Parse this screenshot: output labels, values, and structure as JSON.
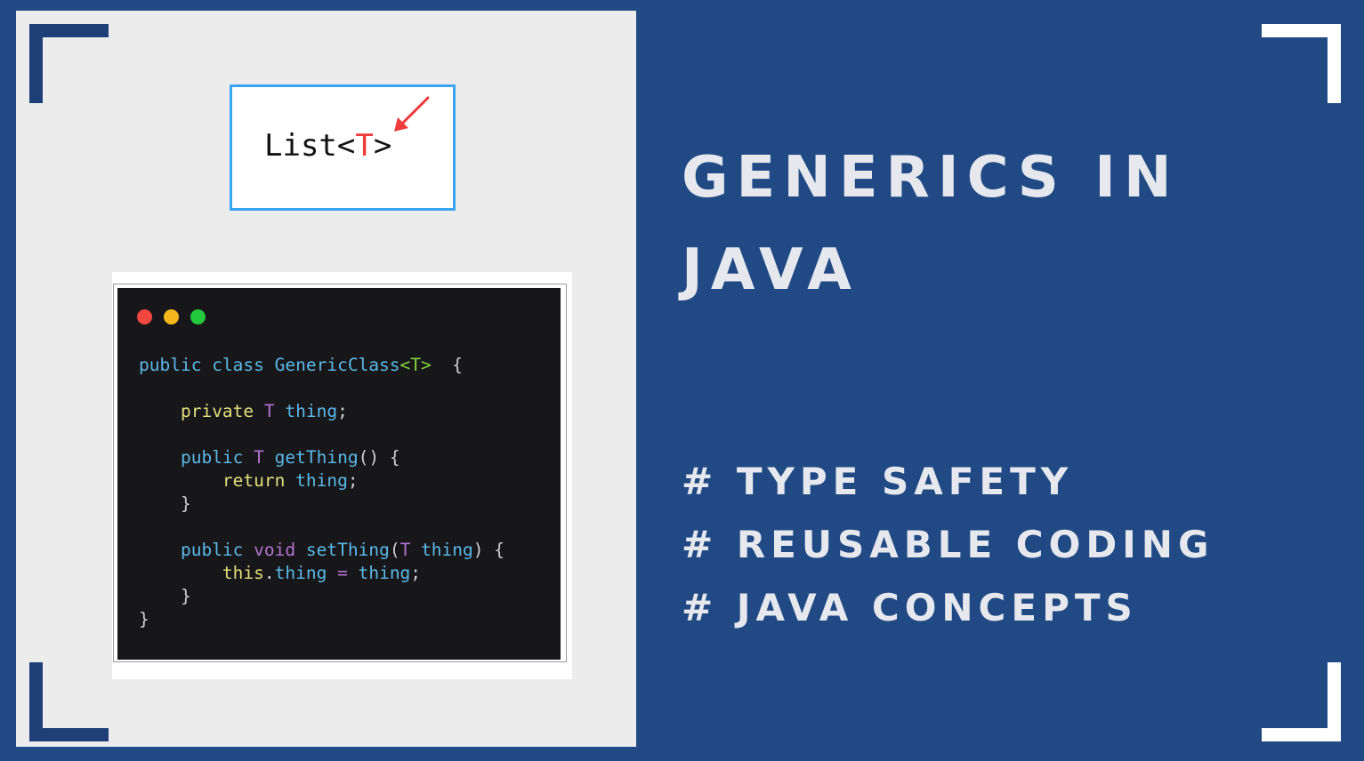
{
  "colors": {
    "page_background": "#214a84",
    "left_panel": "#ececec",
    "bracket_dark": "#1f3f78",
    "bracket_light": "#ffffff",
    "list_box_border": "#3ba5f2",
    "type_param_red": "#ee3b3b",
    "code_background": "#17171a",
    "title_text": "#e6e8ee"
  },
  "list_snippet": {
    "prefix": "List<",
    "type_param": "T",
    "suffix": ">",
    "arrow_icon": "red-arrow"
  },
  "code_window": {
    "dots": [
      "red",
      "yellow",
      "green"
    ],
    "lines": [
      "public class GenericClass<T>  {",
      "",
      "    private T thing;",
      "",
      "    public T getThing() {",
      "        return thing;",
      "    }",
      "",
      "    public void setThing(T thing) {",
      "        this.thing = thing;",
      "    }",
      "}"
    ]
  },
  "title": {
    "line1": "GENERICS IN",
    "line2": "JAVA"
  },
  "tags": [
    "# TYPE SAFETY",
    "# REUSABLE CODING",
    "# JAVA CONCEPTS"
  ]
}
